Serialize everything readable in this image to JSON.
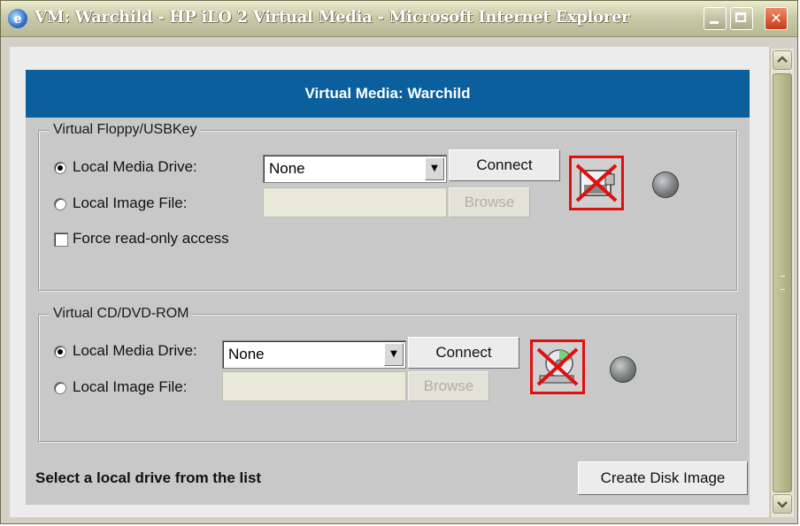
{
  "window": {
    "title": "VM: Warchild - HP iLO 2 Virtual Media - Microsoft Internet Explorer",
    "ie_icon_glyph": "e",
    "close_glyph": "✕"
  },
  "panel": {
    "header": "Virtual Media: Warchild"
  },
  "floppy": {
    "legend": "Virtual Floppy/USBKey",
    "local_media_label": "Local Media Drive:",
    "local_image_label": "Local Image File:",
    "drive_value": "None",
    "connect_label": "Connect",
    "browse_label": "Browse",
    "force_readonly_label": "Force read-only access",
    "selected_source": "Local Media Drive",
    "force_readonly_checked": false
  },
  "cdrom": {
    "legend": "Virtual CD/DVD-ROM",
    "local_media_label": "Local Media Drive:",
    "local_image_label": "Local Image File:",
    "drive_value": "None",
    "connect_label": "Connect",
    "browse_label": "Browse",
    "selected_source": "Local Media Drive"
  },
  "footer": {
    "status": "Select a local drive from the list",
    "create_disk_image_label": "Create Disk Image"
  },
  "icons": {
    "ie": "internet-explorer-icon",
    "minimize": "minimize-icon",
    "maximize": "maximize-icon",
    "close": "close-icon",
    "floppy_status": "floppy-disconnected-icon",
    "cd_status": "cd-disconnected-icon",
    "led": "connection-led-icon",
    "dropdown": "chevron-down-icon"
  },
  "colors": {
    "header_bg": "#0b5f9c",
    "disconnected_border": "#e01010",
    "led_off": "#7a7e7e"
  }
}
